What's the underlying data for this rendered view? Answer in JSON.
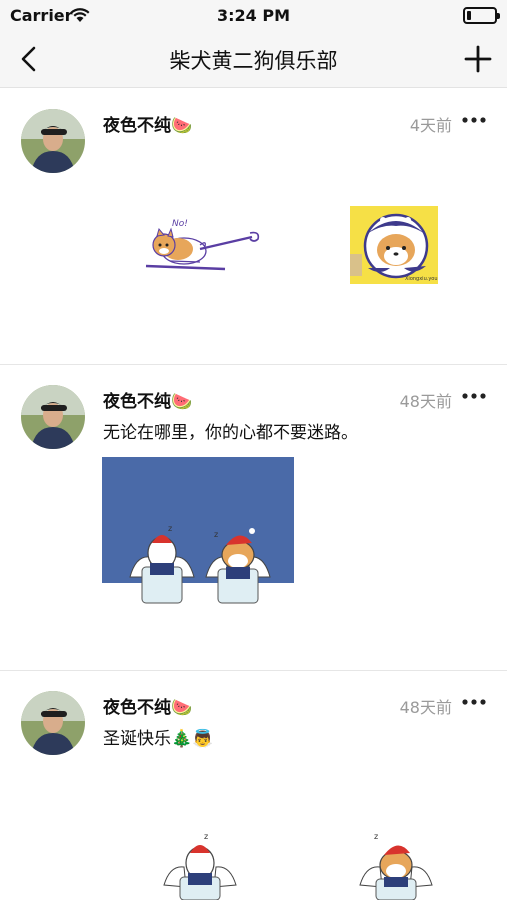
{
  "status_bar": {
    "carrier": "Carrier",
    "time": "3:24 PM",
    "wifi_icon": "wifi-icon",
    "battery_icon": "battery-icon"
  },
  "nav": {
    "title": "柴犬黄二狗俱乐部",
    "back_icon": "chevron-left-icon",
    "add_icon": "plus-icon"
  },
  "posts": [
    {
      "username": "夜色不纯",
      "emoji": "🍉",
      "time": "4天前",
      "content": "",
      "images": [
        "shiba-dog-sticker",
        "shiba-astronaut-sticker"
      ]
    },
    {
      "username": "夜色不纯",
      "emoji": "🍉",
      "time": "48天前",
      "content": "无论在哪里，你的心都不要迷路。",
      "images": [
        "christmas-angels-sticker"
      ]
    },
    {
      "username": "夜色不纯",
      "emoji": "🍉",
      "time": "48天前",
      "content": "圣诞快乐🎄👼",
      "images": [
        "angel-dog-sticker",
        "angel-shiba-sticker"
      ]
    }
  ],
  "colors": {
    "bar_bg": "#f6f6f6",
    "time_gray": "#9a9a9a",
    "sticker_purple": "#5a3ea3",
    "sticker_yellow": "#f6e046",
    "sticker_blue": "#4a6aa8",
    "shiba_orange": "#e7a65a"
  }
}
